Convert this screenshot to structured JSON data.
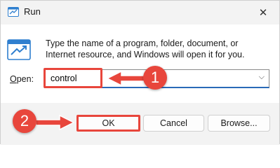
{
  "window": {
    "title": "Run",
    "close_glyph": "✕"
  },
  "dialog": {
    "description": "Type the name of a program, folder, document, or Internet resource, and Windows will open it for you.",
    "open_label_prefix": "O",
    "open_label_rest": "pen:",
    "input_value": "control",
    "dropdown_glyph": "⌵"
  },
  "buttons": {
    "ok": "OK",
    "cancel": "Cancel",
    "browse": "Browse..."
  },
  "annotations": {
    "step1": "1",
    "step2": "2",
    "accent_color": "#e8463c"
  },
  "icons": {
    "title": "run-app-icon",
    "big": "run-app-icon",
    "close": "close-icon",
    "dropdown": "chevron-down-icon",
    "arrow": "arrow-icon"
  }
}
